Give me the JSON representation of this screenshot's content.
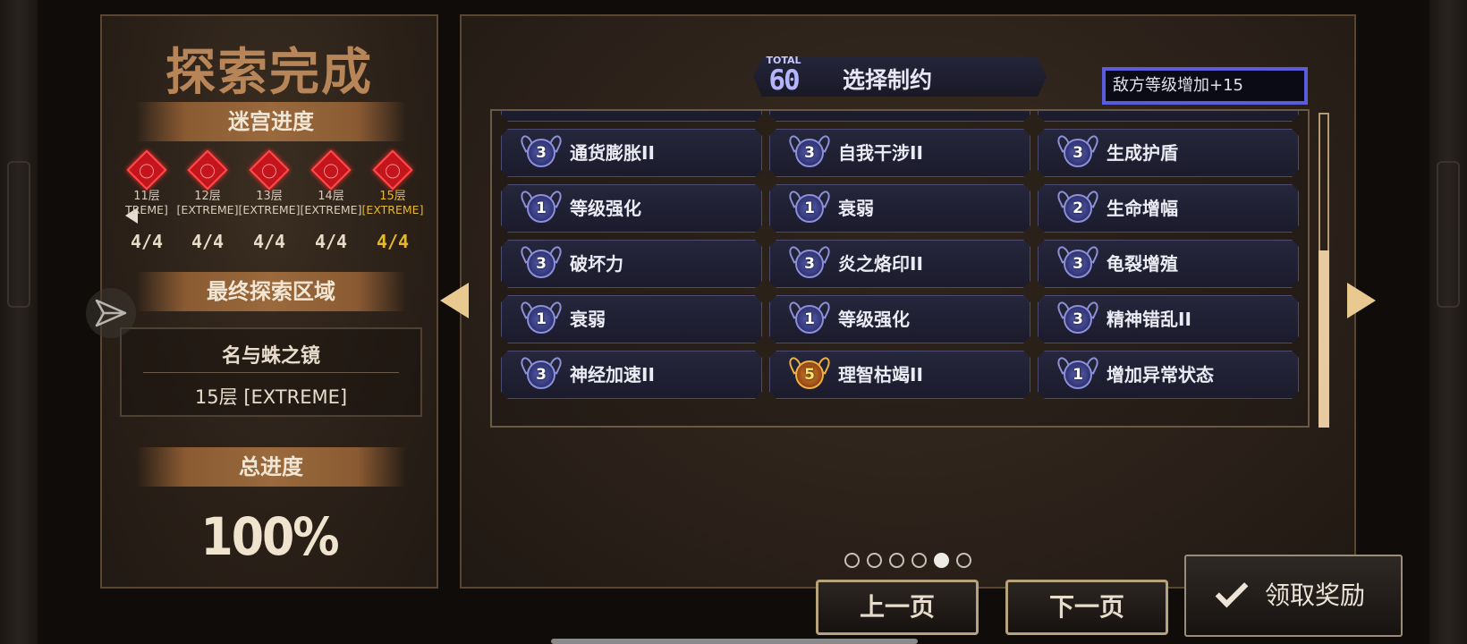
{
  "left": {
    "title": "探索完成",
    "maze_progress_label": "迷宫进度",
    "floors": [
      {
        "name": "11层",
        "difficulty": "TREME]",
        "count": "4/4",
        "active": false
      },
      {
        "name": "12层",
        "difficulty": "[EXTREME]",
        "count": "4/4",
        "active": false
      },
      {
        "name": "13层",
        "difficulty": "[EXTREME]",
        "count": "4/4",
        "active": false
      },
      {
        "name": "14层",
        "difficulty": "[EXTREME]",
        "count": "4/4",
        "active": false
      },
      {
        "name": "15层",
        "difficulty": "[EXTREME]",
        "count": "4/4",
        "active": true
      }
    ],
    "final_area_label": "最终探索区域",
    "final_area_name": "名与蛛之镜",
    "final_area_floor": "15层 [EXTREME]",
    "total_progress_label": "总进度",
    "total_progress_value": "100%"
  },
  "right": {
    "total_label": "TOTAL",
    "total_value": "60",
    "select_title": "选择制约",
    "tooltip": "敌方等级增加+15",
    "restrictions": [
      [
        {
          "level": "3",
          "name": "通货膨胀II"
        },
        {
          "level": "3",
          "name": "自我干涉II"
        },
        {
          "level": "3",
          "name": "生成护盾"
        }
      ],
      [
        {
          "level": "1",
          "name": "等级强化"
        },
        {
          "level": "1",
          "name": "衰弱"
        },
        {
          "level": "2",
          "name": "生命增幅"
        }
      ],
      [
        {
          "level": "3",
          "name": "破坏力"
        },
        {
          "level": "3",
          "name": "炎之烙印II"
        },
        {
          "level": "3",
          "name": "龟裂增殖"
        }
      ],
      [
        {
          "level": "1",
          "name": "衰弱"
        },
        {
          "level": "1",
          "name": "等级强化"
        },
        {
          "level": "3",
          "name": "精神错乱II"
        }
      ],
      [
        {
          "level": "3",
          "name": "神经加速II"
        },
        {
          "level": "5",
          "name": "理智枯竭II",
          "gold": true
        },
        {
          "level": "1",
          "name": "增加异常状态"
        }
      ]
    ],
    "page_dots": 6,
    "active_page": 5,
    "prev_page_label": "上一页",
    "next_page_label": "下一页",
    "claim_label": "领取奖励"
  }
}
